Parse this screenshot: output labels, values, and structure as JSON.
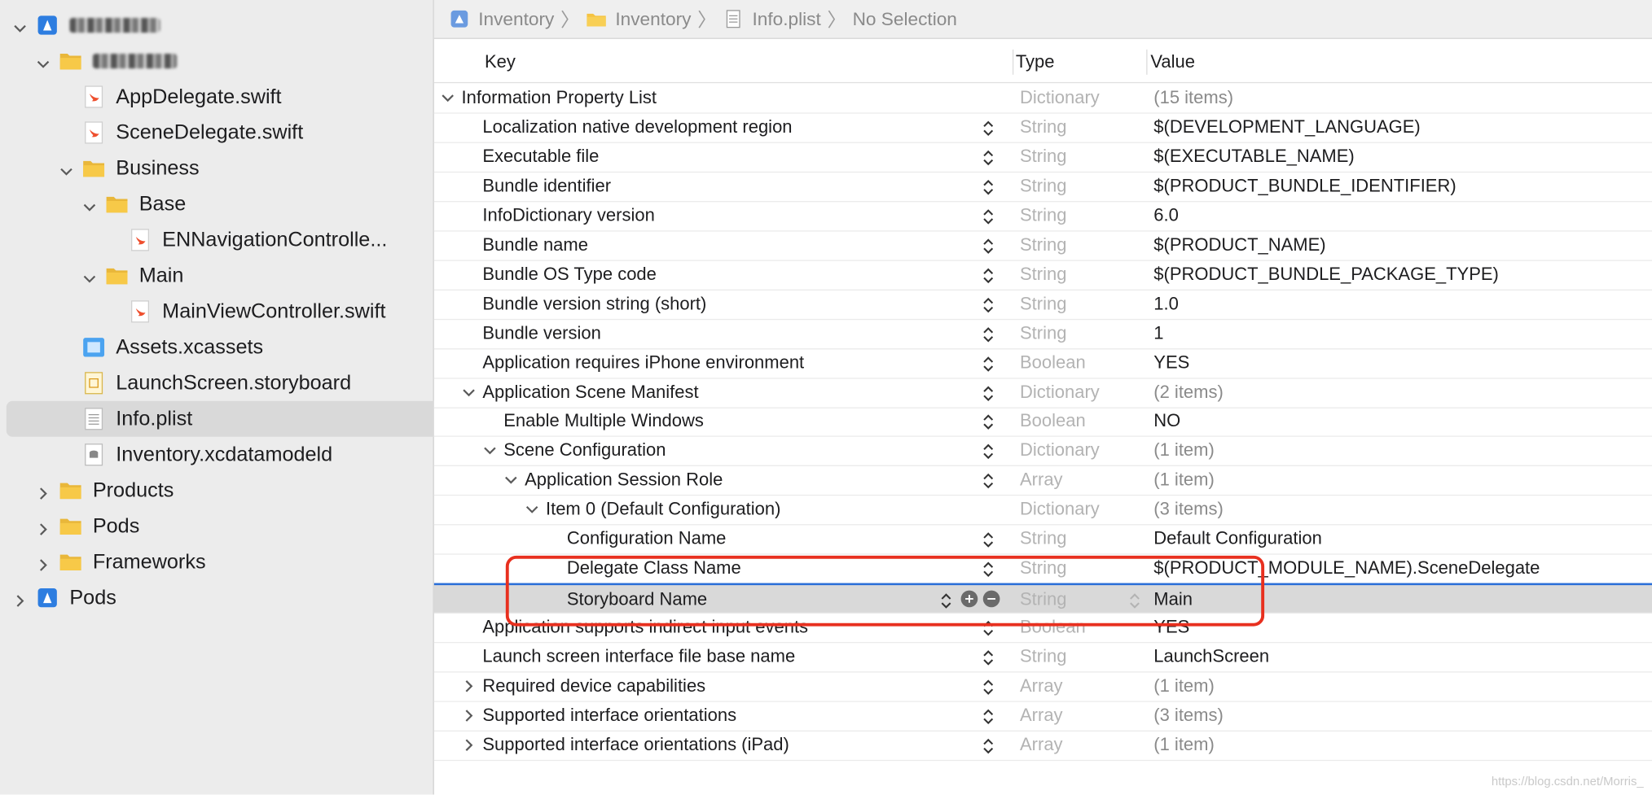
{
  "sidebar": {
    "items": [
      {
        "label": "",
        "depth": 0,
        "icon": "project-icon",
        "expanded": true,
        "blurred": true,
        "blurWidth": 86
      },
      {
        "label": "",
        "depth": 1,
        "icon": "folder-icon",
        "expanded": true,
        "blurred": true,
        "blurWidth": 80
      },
      {
        "label": "AppDelegate.swift",
        "depth": 2,
        "icon": "swift-file-icon"
      },
      {
        "label": "SceneDelegate.swift",
        "depth": 2,
        "icon": "swift-file-icon"
      },
      {
        "label": "Business",
        "depth": 2,
        "icon": "folder-icon",
        "expanded": true
      },
      {
        "label": "Base",
        "depth": 3,
        "icon": "folder-icon",
        "expanded": true
      },
      {
        "label": "ENNavigationControlle...",
        "depth": 4,
        "icon": "swift-file-icon"
      },
      {
        "label": "Main",
        "depth": 3,
        "icon": "folder-icon",
        "expanded": true
      },
      {
        "label": "MainViewController.swift",
        "depth": 4,
        "icon": "swift-file-icon"
      },
      {
        "label": "Assets.xcassets",
        "depth": 2,
        "icon": "assets-icon"
      },
      {
        "label": "LaunchScreen.storyboard",
        "depth": 2,
        "icon": "storyboard-icon"
      },
      {
        "label": "Info.plist",
        "depth": 2,
        "icon": "plist-file-icon",
        "selected": true
      },
      {
        "label": "Inventory.xcdatamodeld",
        "depth": 2,
        "icon": "datamodel-icon"
      },
      {
        "label": "Products",
        "depth": 1,
        "icon": "folder-icon",
        "expanded": false
      },
      {
        "label": "Pods",
        "depth": 1,
        "icon": "folder-icon",
        "expanded": false
      },
      {
        "label": "Frameworks",
        "depth": 1,
        "icon": "folder-icon",
        "expanded": false
      },
      {
        "label": "Pods",
        "depth": 0,
        "icon": "project-icon",
        "expanded": false
      }
    ]
  },
  "jumpbar": {
    "crumbs": [
      "Inventory",
      "Inventory",
      "Info.plist",
      "No Selection"
    ]
  },
  "editor": {
    "columns": {
      "key": "Key",
      "type": "Type",
      "value": "Value"
    },
    "rows": [
      {
        "key": "Information Property List",
        "type": "Dictionary",
        "value": "(15 items)",
        "depth": 0,
        "disclosure": "open",
        "stepper": false,
        "muted": true
      },
      {
        "key": "Localization native development region",
        "type": "String",
        "value": "$(DEVELOPMENT_LANGUAGE)",
        "depth": 1
      },
      {
        "key": "Executable file",
        "type": "String",
        "value": "$(EXECUTABLE_NAME)",
        "depth": 1
      },
      {
        "key": "Bundle identifier",
        "type": "String",
        "value": "$(PRODUCT_BUNDLE_IDENTIFIER)",
        "depth": 1
      },
      {
        "key": "InfoDictionary version",
        "type": "String",
        "value": "6.0",
        "depth": 1
      },
      {
        "key": "Bundle name",
        "type": "String",
        "value": "$(PRODUCT_NAME)",
        "depth": 1
      },
      {
        "key": "Bundle OS Type code",
        "type": "String",
        "value": "$(PRODUCT_BUNDLE_PACKAGE_TYPE)",
        "depth": 1
      },
      {
        "key": "Bundle version string (short)",
        "type": "String",
        "value": "1.0",
        "depth": 1
      },
      {
        "key": "Bundle version",
        "type": "String",
        "value": "1",
        "depth": 1
      },
      {
        "key": "Application requires iPhone environment",
        "type": "Boolean",
        "value": "YES",
        "depth": 1
      },
      {
        "key": "Application Scene Manifest",
        "type": "Dictionary",
        "value": "(2 items)",
        "depth": 1,
        "disclosure": "open",
        "muted": true
      },
      {
        "key": "Enable Multiple Windows",
        "type": "Boolean",
        "value": "NO",
        "depth": 2
      },
      {
        "key": "Scene Configuration",
        "type": "Dictionary",
        "value": "(1 item)",
        "depth": 2,
        "disclosure": "open",
        "muted": true
      },
      {
        "key": "Application Session Role",
        "type": "Array",
        "value": "(1 item)",
        "depth": 3,
        "disclosure": "open",
        "muted": true
      },
      {
        "key": "Item 0 (Default Configuration)",
        "type": "Dictionary",
        "value": "(3 items)",
        "depth": 4,
        "disclosure": "open",
        "stepper": false,
        "muted": true
      },
      {
        "key": "Configuration Name",
        "type": "String",
        "value": "Default Configuration",
        "depth": 5
      },
      {
        "key": "Delegate Class Name",
        "type": "String",
        "value": "$(PRODUCT_MODULE_NAME).SceneDelegate",
        "depth": 5
      },
      {
        "key": "Storyboard Name",
        "type": "String",
        "value": "Main",
        "depth": 5,
        "selected": true
      },
      {
        "key": "Application supports indirect input events",
        "type": "Boolean",
        "value": "YES",
        "depth": 1
      },
      {
        "key": "Launch screen interface file base name",
        "type": "String",
        "value": "LaunchScreen",
        "depth": 1
      },
      {
        "key": "Required device capabilities",
        "type": "Array",
        "value": "(1 item)",
        "depth": 1,
        "disclosure": "closed",
        "muted": true
      },
      {
        "key": "Supported interface orientations",
        "type": "Array",
        "value": "(3 items)",
        "depth": 1,
        "disclosure": "closed",
        "muted": true
      },
      {
        "key": "Supported interface orientations (iPad)",
        "type": "Array",
        "value": "(1 item)",
        "depth": 1,
        "disclosure": "closed",
        "muted": true
      }
    ]
  },
  "annotation": {
    "color": "#e8301f"
  },
  "watermark": "https://blog.csdn.net/Morris_"
}
